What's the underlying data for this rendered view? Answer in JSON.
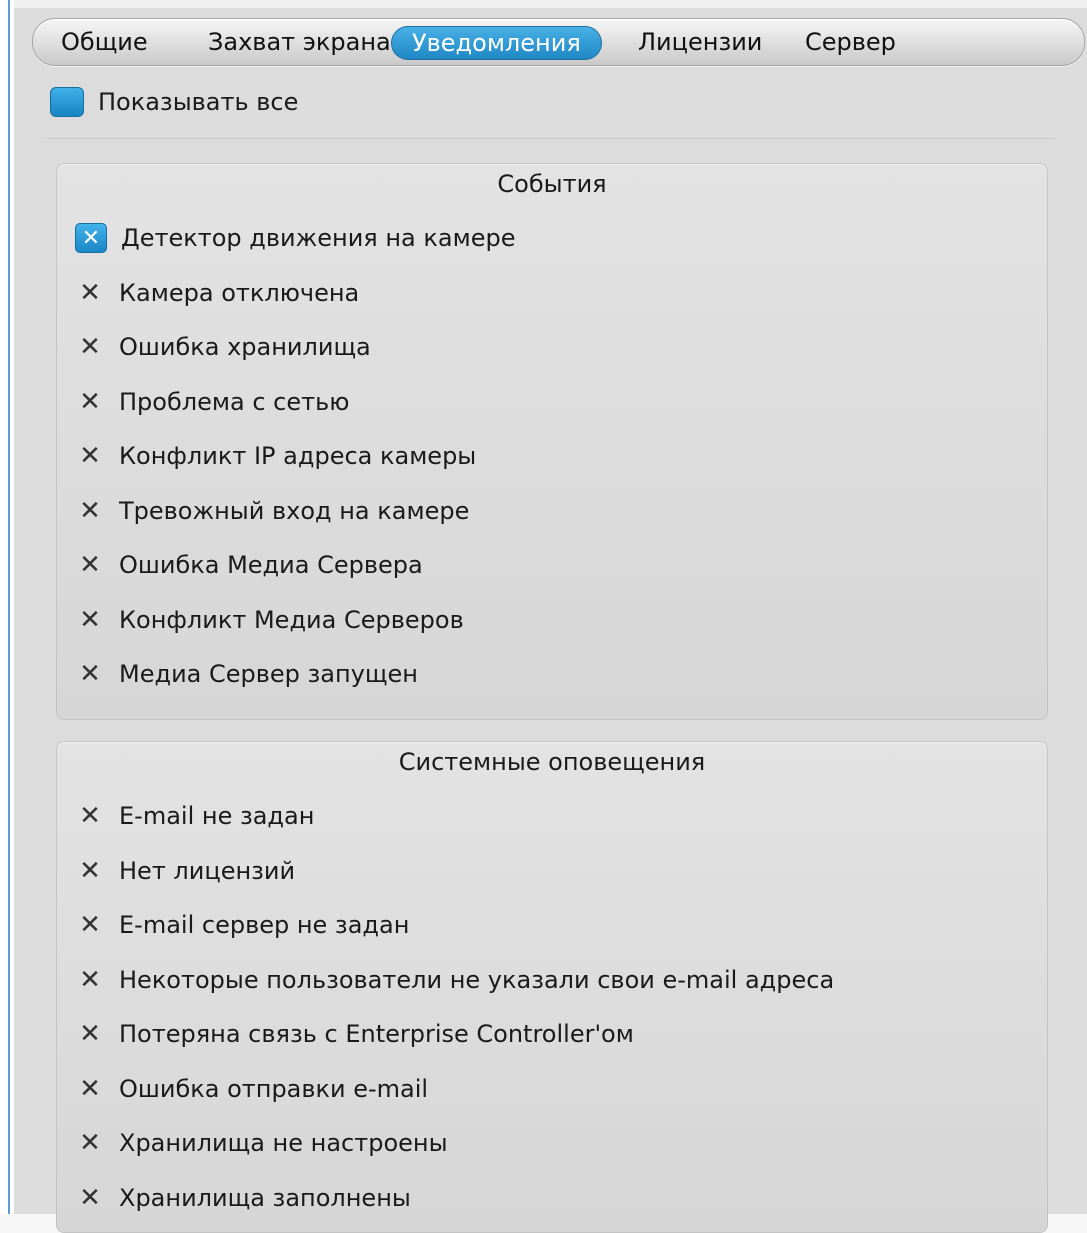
{
  "tabs": [
    {
      "label": "Общие",
      "active": false
    },
    {
      "label": "Захват экрана",
      "active": false
    },
    {
      "label": "Уведомления",
      "active": true
    },
    {
      "label": "Лицензии",
      "active": false
    },
    {
      "label": "Сервер",
      "active": false
    }
  ],
  "show_all": {
    "label": "Показывать все"
  },
  "events": {
    "title": "События",
    "items": [
      {
        "label": "Детектор движения на камере",
        "checked": true
      },
      {
        "label": "Камера отключена",
        "checked": false
      },
      {
        "label": "Ошибка хранилища",
        "checked": false
      },
      {
        "label": "Проблема с сетью",
        "checked": false
      },
      {
        "label": "Конфликт IP адреса камеры",
        "checked": false
      },
      {
        "label": "Тревожный вход на камере",
        "checked": false
      },
      {
        "label": "Ошибка Медиа Сервера",
        "checked": false
      },
      {
        "label": "Конфликт Медиа Серверов",
        "checked": false
      },
      {
        "label": "Медиа Сервер запущен",
        "checked": false
      }
    ]
  },
  "system_alerts": {
    "title": "Системные оповещения",
    "items": [
      {
        "label": "E-mail не задан",
        "checked": false
      },
      {
        "label": "Нет лицензий",
        "checked": false
      },
      {
        "label": "E-mail сервер не задан",
        "checked": false
      },
      {
        "label": "Некоторые пользователи не указали свои e-mail адреса",
        "checked": false
      },
      {
        "label": "Потеряна связь с Enterprise Controller'ом",
        "checked": false
      },
      {
        "label": "Ошибка отправки e-mail",
        "checked": false
      },
      {
        "label": "Хранилища не настроены",
        "checked": false
      },
      {
        "label": "Хранилища заполнены",
        "checked": false
      }
    ]
  },
  "colors": {
    "accent": "#1f87c4",
    "panel": "#dcdcdc"
  }
}
